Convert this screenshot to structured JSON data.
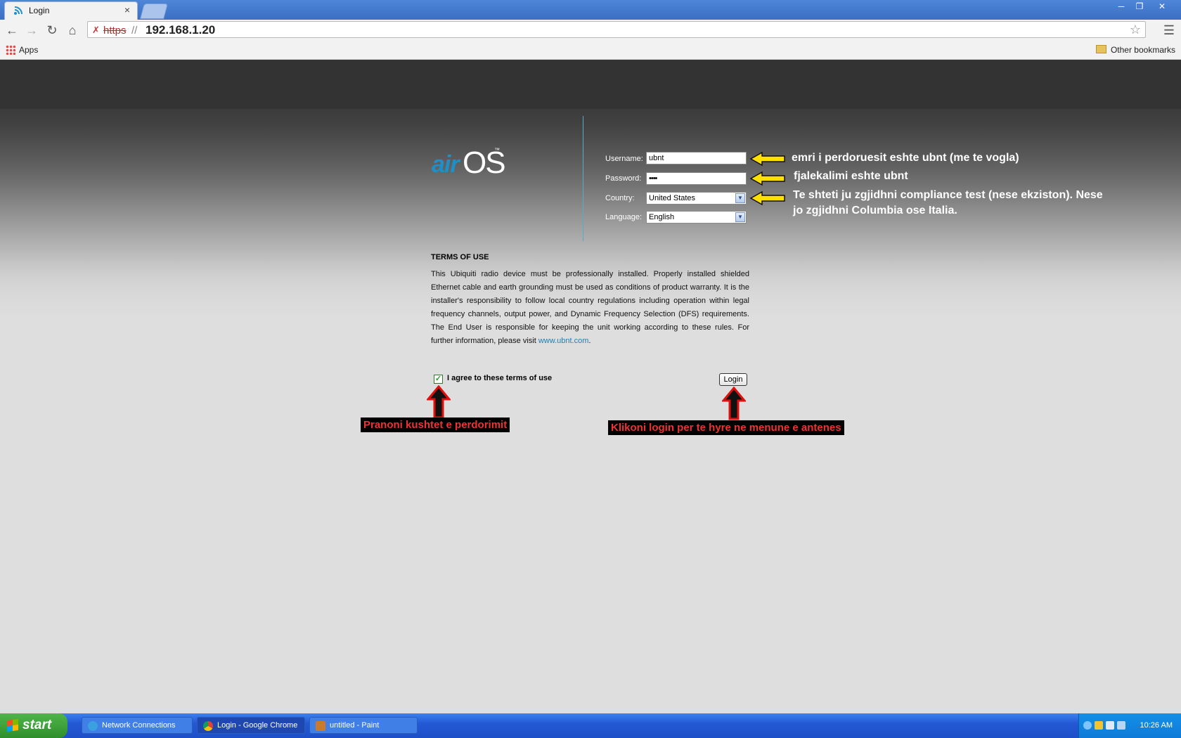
{
  "browser": {
    "tab_title": "Login",
    "tab_close": "×",
    "url_scheme": "https",
    "url_slashes": "//",
    "url_host": "192.168.1.20",
    "bookmarks": {
      "apps_label": "Apps",
      "other_label": "Other bookmarks"
    }
  },
  "login_page": {
    "logo_air": "air",
    "logo_os": "OS",
    "logo_tm": "™",
    "form": {
      "username_label": "Username:",
      "username_value": "ubnt",
      "password_label": "Password:",
      "password_value": "••••",
      "country_label": "Country:",
      "country_value": "United States",
      "language_label": "Language:",
      "language_value": "English"
    },
    "terms": {
      "title": "TERMS OF USE",
      "body": "This Ubiquiti radio device must be professionally installed. Properly installed shielded Ethernet cable and earth grounding must be used as conditions of product warranty. It is the installer's responsibility to follow local country regulations including operation within legal frequency channels, output power, and Dynamic Frequency Selection (DFS) requirements. The End User is responsible for keeping the unit working according to these rules. For further information, please visit ",
      "link": "www.ubnt.com",
      "after_link": "."
    },
    "agree_label": "I agree to these terms of use",
    "agree_checked": true,
    "login_button": "Login"
  },
  "annotations": {
    "username_note": "emri i perdoruesit eshte ubnt (me te vogla)",
    "password_note": "fjalekalimi eshte ubnt",
    "country_note_line1": "Te shteti ju zgjidhni compliance test (nese ekziston). Nese",
    "country_note_line2": "jo zgjidhni Columbia ose Italia.",
    "agree_note": "Pranoni kushtet e perdorimit",
    "login_note": "Klikoni login per te hyre ne menune e antenes",
    "colors": {
      "arrow_yellow": "#ffe000",
      "arrow_red": "#e01010",
      "label_red": "#e33333"
    }
  },
  "taskbar": {
    "start_label": "start",
    "items": [
      {
        "label": "Network Connections",
        "icon": "network-icon"
      },
      {
        "label": "Login - Google Chrome",
        "icon": "chrome-icon"
      },
      {
        "label": "untitled - Paint",
        "icon": "paint-icon"
      }
    ],
    "clock": "10:26 AM"
  }
}
